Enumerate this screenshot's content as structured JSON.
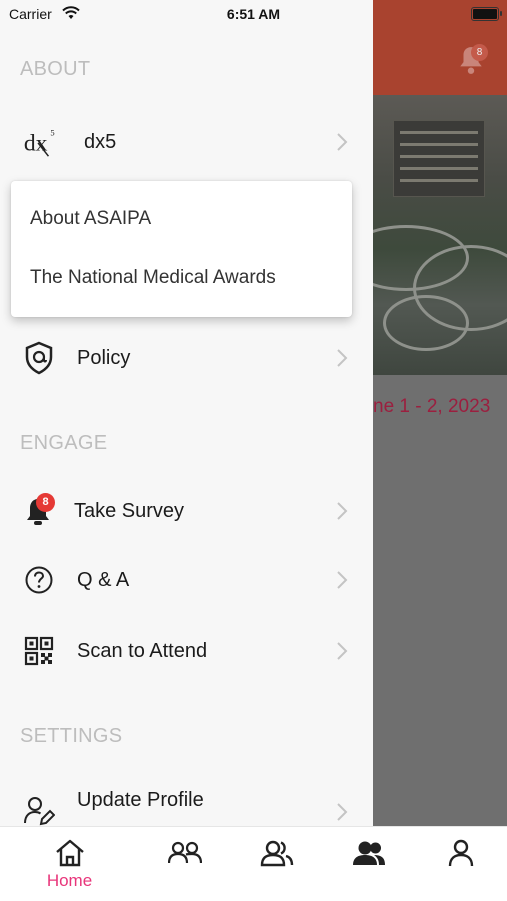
{
  "status_bar": {
    "carrier": "Carrier",
    "time": "6:51 AM"
  },
  "background": {
    "notification_count": "8",
    "event_date": "ne 1 - 2, 2023"
  },
  "drawer": {
    "about": {
      "title": "ABOUT",
      "dx5_label": "dx5",
      "dx5_logo_text": "dx",
      "dx5_logo_sup": "5",
      "submenu": [
        "About ASAIPA",
        "The National Medical Awards"
      ],
      "policy_label": "Policy"
    },
    "engage": {
      "title": "ENGAGE",
      "survey_label": "Take Survey",
      "survey_badge": "8",
      "qa_label": "Q & A",
      "scan_label": "Scan to Attend"
    },
    "settings": {
      "title": "SETTINGS",
      "update_profile_label": "Update Profile"
    }
  },
  "tabbar": {
    "home_label": "Home",
    "active_color": "#e8357a"
  }
}
